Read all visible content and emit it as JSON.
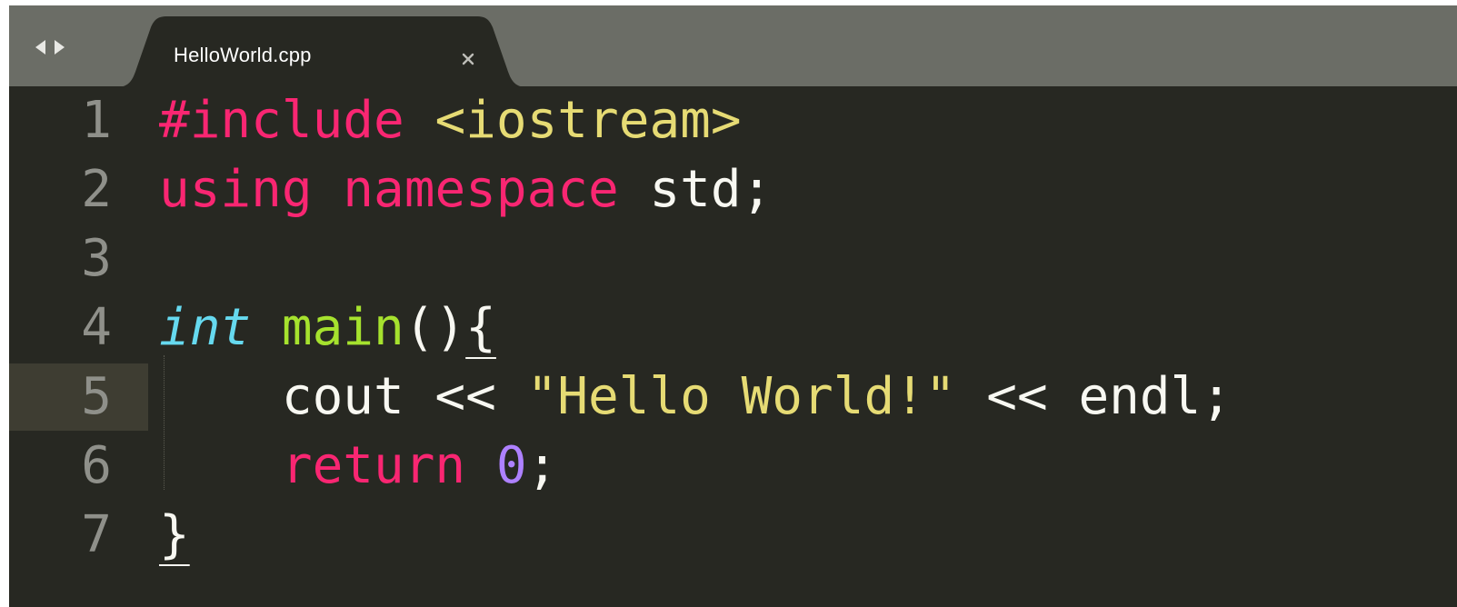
{
  "tab": {
    "filename": "HelloWorld.cpp"
  },
  "icons": {
    "nav_left": "left-arrow-icon",
    "nav_right": "right-arrow-icon",
    "close": "close-icon"
  },
  "colors": {
    "background": "#272822",
    "tabbar": "#6b6d66",
    "keyword": "#f92672",
    "string": "#e6db74",
    "type": "#66d9ef",
    "function": "#a6e22e",
    "number": "#ae81ff",
    "text": "#f8f8f2"
  },
  "editor": {
    "active_line": 5,
    "lines": [
      {
        "number": "1",
        "tokens": [
          {
            "text": "#include",
            "cls": "kw"
          },
          {
            "text": " ",
            "cls": ""
          },
          {
            "text": "<iostream>",
            "cls": "str"
          }
        ]
      },
      {
        "number": "2",
        "tokens": [
          {
            "text": "using",
            "cls": "kw"
          },
          {
            "text": " ",
            "cls": ""
          },
          {
            "text": "namespace",
            "cls": "kw"
          },
          {
            "text": " std;",
            "cls": ""
          }
        ]
      },
      {
        "number": "3",
        "tokens": []
      },
      {
        "number": "4",
        "tokens": [
          {
            "text": "int",
            "cls": "type"
          },
          {
            "text": " ",
            "cls": ""
          },
          {
            "text": "main",
            "cls": "fn"
          },
          {
            "text": "()",
            "cls": ""
          },
          {
            "text": "{",
            "cls": "brace-match"
          }
        ]
      },
      {
        "number": "5",
        "tokens": [
          {
            "text": "    cout << ",
            "cls": ""
          },
          {
            "text": "\"Hello World!\"",
            "cls": "str"
          },
          {
            "text": " << endl;",
            "cls": ""
          }
        ]
      },
      {
        "number": "6",
        "tokens": [
          {
            "text": "    ",
            "cls": ""
          },
          {
            "text": "return",
            "cls": "kw"
          },
          {
            "text": " ",
            "cls": ""
          },
          {
            "text": "0",
            "cls": "num"
          },
          {
            "text": ";",
            "cls": ""
          }
        ]
      },
      {
        "number": "7",
        "tokens": [
          {
            "text": "}",
            "cls": "brace-match"
          }
        ]
      }
    ]
  }
}
